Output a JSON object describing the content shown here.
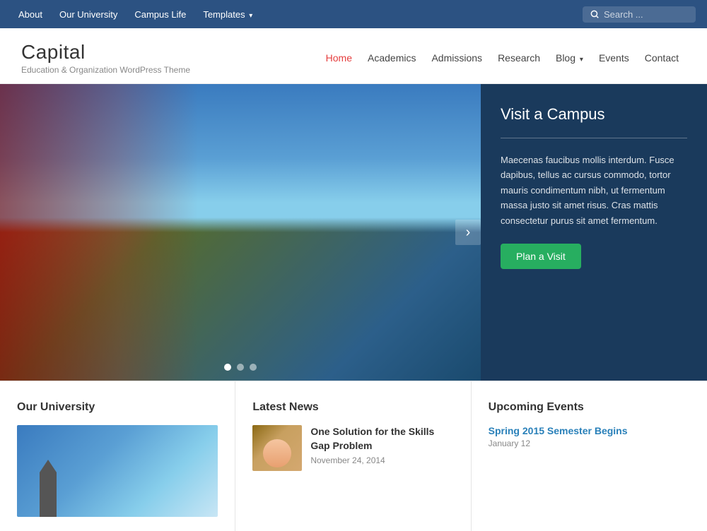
{
  "topbar": {
    "nav_items": [
      {
        "label": "About",
        "href": "#"
      },
      {
        "label": "Our University",
        "href": "#"
      },
      {
        "label": "Campus Life",
        "href": "#"
      },
      {
        "label": "Templates",
        "href": "#",
        "has_dropdown": true
      }
    ],
    "search_placeholder": "Search ..."
  },
  "site": {
    "title": "Capital",
    "tagline": "Education & Organization WordPress Theme"
  },
  "main_nav": [
    {
      "label": "Home",
      "href": "#",
      "active": true
    },
    {
      "label": "Academics",
      "href": "#"
    },
    {
      "label": "Admissions",
      "href": "#"
    },
    {
      "label": "Research",
      "href": "#"
    },
    {
      "label": "Blog",
      "href": "#",
      "has_dropdown": true
    },
    {
      "label": "Events",
      "href": "#"
    },
    {
      "label": "Contact",
      "href": "#"
    }
  ],
  "hero": {
    "sidebar_title": "Visit a Campus",
    "sidebar_body": "Maecenas faucibus mollis interdum. Fusce dapibus, tellus ac cursus commodo, tortor mauris condimentum nibh, ut fermentum massa justo sit amet risus. Cras mattis consectetur purus sit amet fermentum.",
    "cta_label": "Plan a Visit",
    "slider_next_label": "›",
    "dots": [
      {
        "active": true
      },
      {
        "active": false
      },
      {
        "active": false
      }
    ]
  },
  "sections": {
    "university": {
      "heading": "Our University"
    },
    "news": {
      "heading": "Latest News",
      "items": [
        {
          "title": "One Solution for the Skills Gap Problem",
          "date": "November 24, 2014"
        }
      ]
    },
    "events": {
      "heading": "Upcoming Events",
      "items": [
        {
          "title": "Spring 2015 Semester Begins",
          "date": "January 12"
        }
      ]
    }
  }
}
